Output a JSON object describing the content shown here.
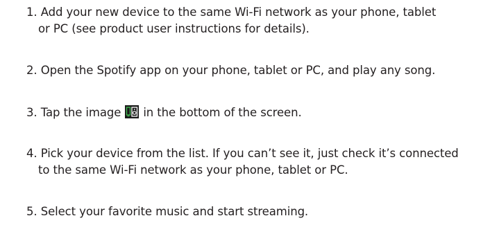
{
  "steps": [
    {
      "number": "1.",
      "line1": "Add your new device to the same Wi-Fi network as your phone, tablet",
      "line2": "or PC (see product user instructions for details)."
    },
    {
      "number": "2.",
      "line1": "Open the Spotify app on your phone, tablet or PC, and play any song."
    },
    {
      "number": "3.",
      "before_icon": "Tap the image",
      "after_icon": "in the bottom of the screen.",
      "icon": "connect-device-icon"
    },
    {
      "number": "4.",
      "line1": "Pick your device from the list. If you can’t see it, just check it’s connected",
      "line2": "to the same Wi-Fi network as your phone, tablet or PC."
    },
    {
      "number": "5.",
      "line1": "Select your favorite music and start streaming."
    }
  ],
  "colors": {
    "text": "#231f20",
    "icon_background": "#1a1a1a",
    "icon_accent": "#3fb34f"
  }
}
